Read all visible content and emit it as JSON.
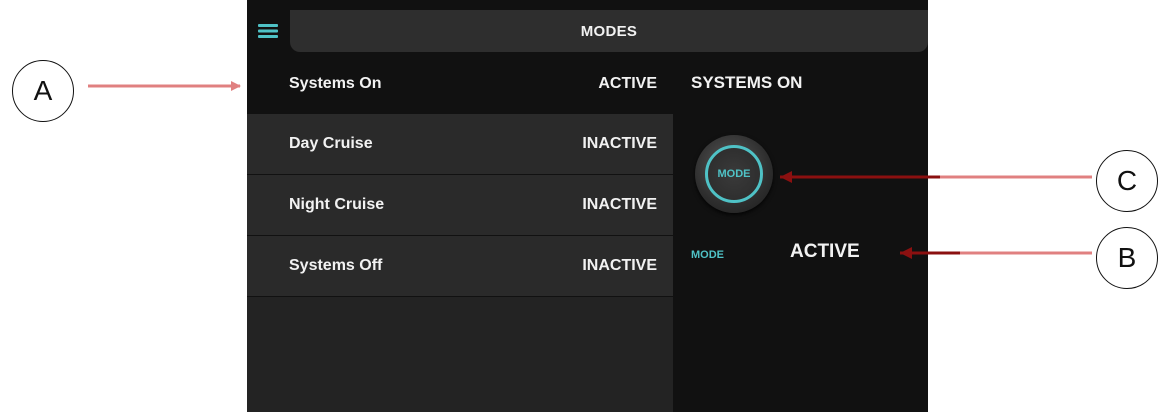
{
  "header": {
    "title": "MODES",
    "menu_icon": "hamburger-menu-icon"
  },
  "modes": [
    {
      "name": "Systems On",
      "state": "ACTIVE"
    },
    {
      "name": "Day Cruise",
      "state": "INACTIVE"
    },
    {
      "name": "Night Cruise",
      "state": "INACTIVE"
    },
    {
      "name": "Systems Off",
      "state": "INACTIVE"
    }
  ],
  "panel": {
    "title": "SYSTEMS ON",
    "button_label": "MODE",
    "mode_label": "MODE",
    "mode_value": "ACTIVE"
  },
  "callouts": {
    "a": "A",
    "b": "B",
    "c": "C"
  },
  "colors": {
    "accent": "#4fc2c6",
    "background": "#111111",
    "row": "#2a2a2a",
    "arrow_light": "#e08080",
    "arrow_dark": "#8b1010"
  }
}
